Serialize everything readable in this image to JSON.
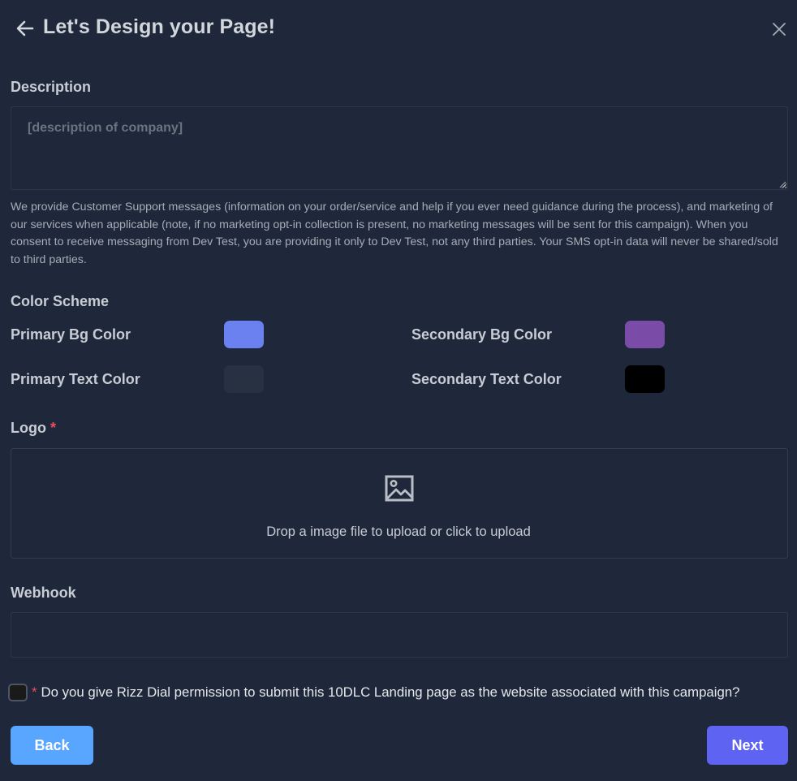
{
  "header": {
    "title": "Let's Design your Page!",
    "back_icon": "arrow-left-icon",
    "close_icon": "close-icon"
  },
  "description": {
    "label": "Description",
    "placeholder": "[description of company]",
    "value": "",
    "info_text": "We provide Customer Support messages (information on your order/service and help if you ever need guidance during the process), and marketing of our services when applicable (note, if no marketing opt-in collection is present, no marketing messages will be sent for this campaign). When you consent to receive messaging from Dev Test, you are providing it only to Dev Test, not any third parties. Your SMS opt-in data will never be shared/sold to third parties."
  },
  "color_scheme": {
    "label": "Color Scheme",
    "primary_bg": {
      "label": "Primary Bg Color",
      "color": "#6b81f0"
    },
    "secondary_bg": {
      "label": "Secondary Bg Color",
      "color": "#7b4ba8"
    },
    "primary_text": {
      "label": "Primary Text Color",
      "color": "#283141"
    },
    "secondary_text": {
      "label": "Secondary Text Color",
      "color": "#000000"
    }
  },
  "logo": {
    "label": "Logo",
    "required_mark": "*",
    "upload_text": "Drop a image file to upload or click to upload",
    "icon": "image-icon"
  },
  "webhook": {
    "label": "Webhook",
    "value": ""
  },
  "consent": {
    "required_mark": "*",
    "text": "Do you give Rizz Dial permission to submit this 10DLC Landing page as the website associated with this campaign?",
    "checked": false
  },
  "footer": {
    "back_label": "Back",
    "next_label": "Next",
    "back_color": "#58a6ff",
    "next_color": "#5f63f2"
  }
}
